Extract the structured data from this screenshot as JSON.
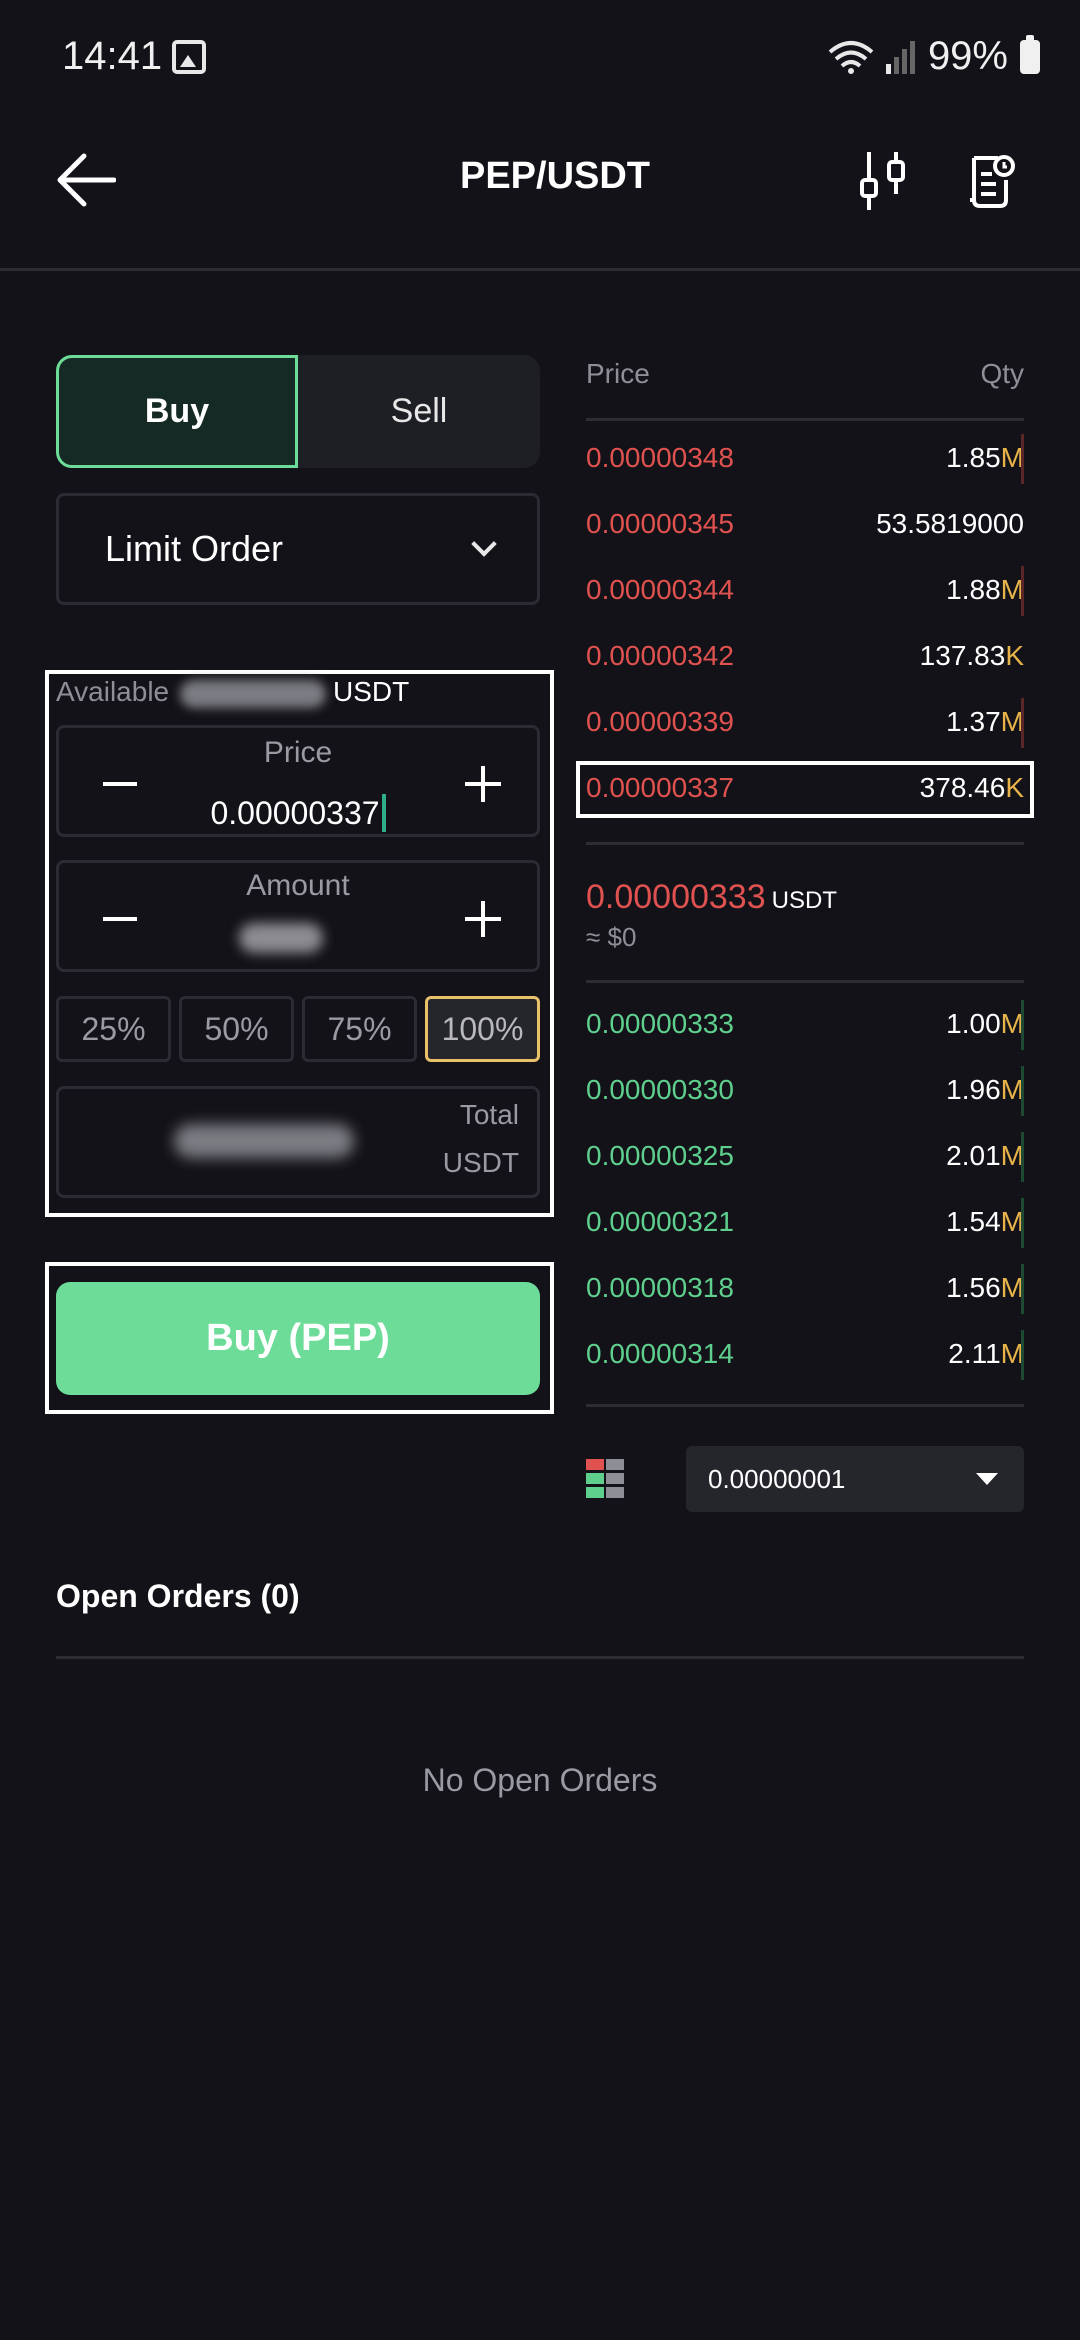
{
  "status_bar": {
    "time": "14:41",
    "battery": "99%"
  },
  "header": {
    "title": "PEP/USDT"
  },
  "side_toggle": {
    "buy": "Buy",
    "sell": "Sell"
  },
  "order_type": {
    "selected": "Limit Order"
  },
  "form": {
    "available_label": "Available",
    "available_unit": "USDT",
    "price_label": "Price",
    "price_value": "0.00000337",
    "amount_label": "Amount",
    "percent_options": [
      "25%",
      "50%",
      "75%",
      "100%"
    ],
    "selected_percent": "100%",
    "total_label": "Total",
    "total_unit": "USDT"
  },
  "buy_button": "Buy (PEP)",
  "order_book": {
    "price_header": "Price",
    "qty_header": "Qty",
    "asks": [
      {
        "price": "0.00000348",
        "qty": "1.85",
        "unit": "M"
      },
      {
        "price": "0.00000345",
        "qty": "53.5819000",
        "unit": ""
      },
      {
        "price": "0.00000344",
        "qty": "1.88",
        "unit": "M"
      },
      {
        "price": "0.00000342",
        "qty": "137.83",
        "unit": "K"
      },
      {
        "price": "0.00000339",
        "qty": "1.37",
        "unit": "M"
      },
      {
        "price": "0.00000337",
        "qty": "378.46",
        "unit": "K"
      }
    ],
    "last_price": "0.00000333",
    "last_price_unit": "USDT",
    "last_price_usd": "≈ $0",
    "bids": [
      {
        "price": "0.00000333",
        "qty": "1.00",
        "unit": "M"
      },
      {
        "price": "0.00000330",
        "qty": "1.96",
        "unit": "M"
      },
      {
        "price": "0.00000325",
        "qty": "2.01",
        "unit": "M"
      },
      {
        "price": "0.00000321",
        "qty": "1.54",
        "unit": "M"
      },
      {
        "price": "0.00000318",
        "qty": "1.56",
        "unit": "M"
      },
      {
        "price": "0.00000314",
        "qty": "2.11",
        "unit": "M"
      }
    ],
    "tick_size": "0.00000001"
  },
  "open_orders": {
    "title": "Open Orders (0)",
    "empty_message": "No Open Orders"
  },
  "colors": {
    "buy_green": "#6cdc98",
    "ask_red": "#e0524f",
    "bid_green": "#5fcf8e",
    "unit_gold": "#e8b44a",
    "background": "#121218"
  },
  "icons": [
    "image-icon",
    "wifi-icon",
    "signal-icon",
    "battery-icon",
    "back-arrow-icon",
    "candlestick-chart-icon",
    "order-history-icon",
    "chevron-down-icon",
    "minus-icon",
    "plus-icon",
    "book-layout-icon",
    "triangle-down-icon"
  ]
}
